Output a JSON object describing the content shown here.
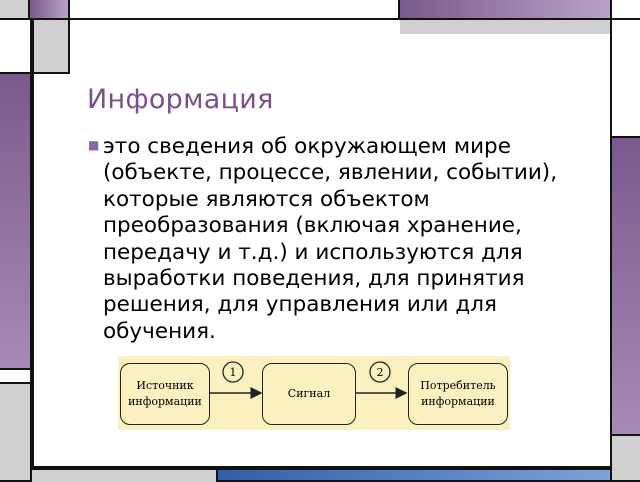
{
  "slide": {
    "title": "Информация",
    "bullet": "это сведения об окружающем мире (объекте, процессе, явлении, событии), которые являются объектом преобразования (включая хранение, передачу и т.д.) и используются для выработки поведения, для принятия решения, для управления или для обучения."
  },
  "diagram": {
    "source": "Источник информации",
    "signal": "Сигнал",
    "consumer": "Потребитель информации",
    "step1": "1",
    "step2": "2"
  },
  "colors": {
    "title": "#7a4f8c",
    "bullet": "#8b63a8",
    "diagram_bg": "#fbf0bf"
  }
}
